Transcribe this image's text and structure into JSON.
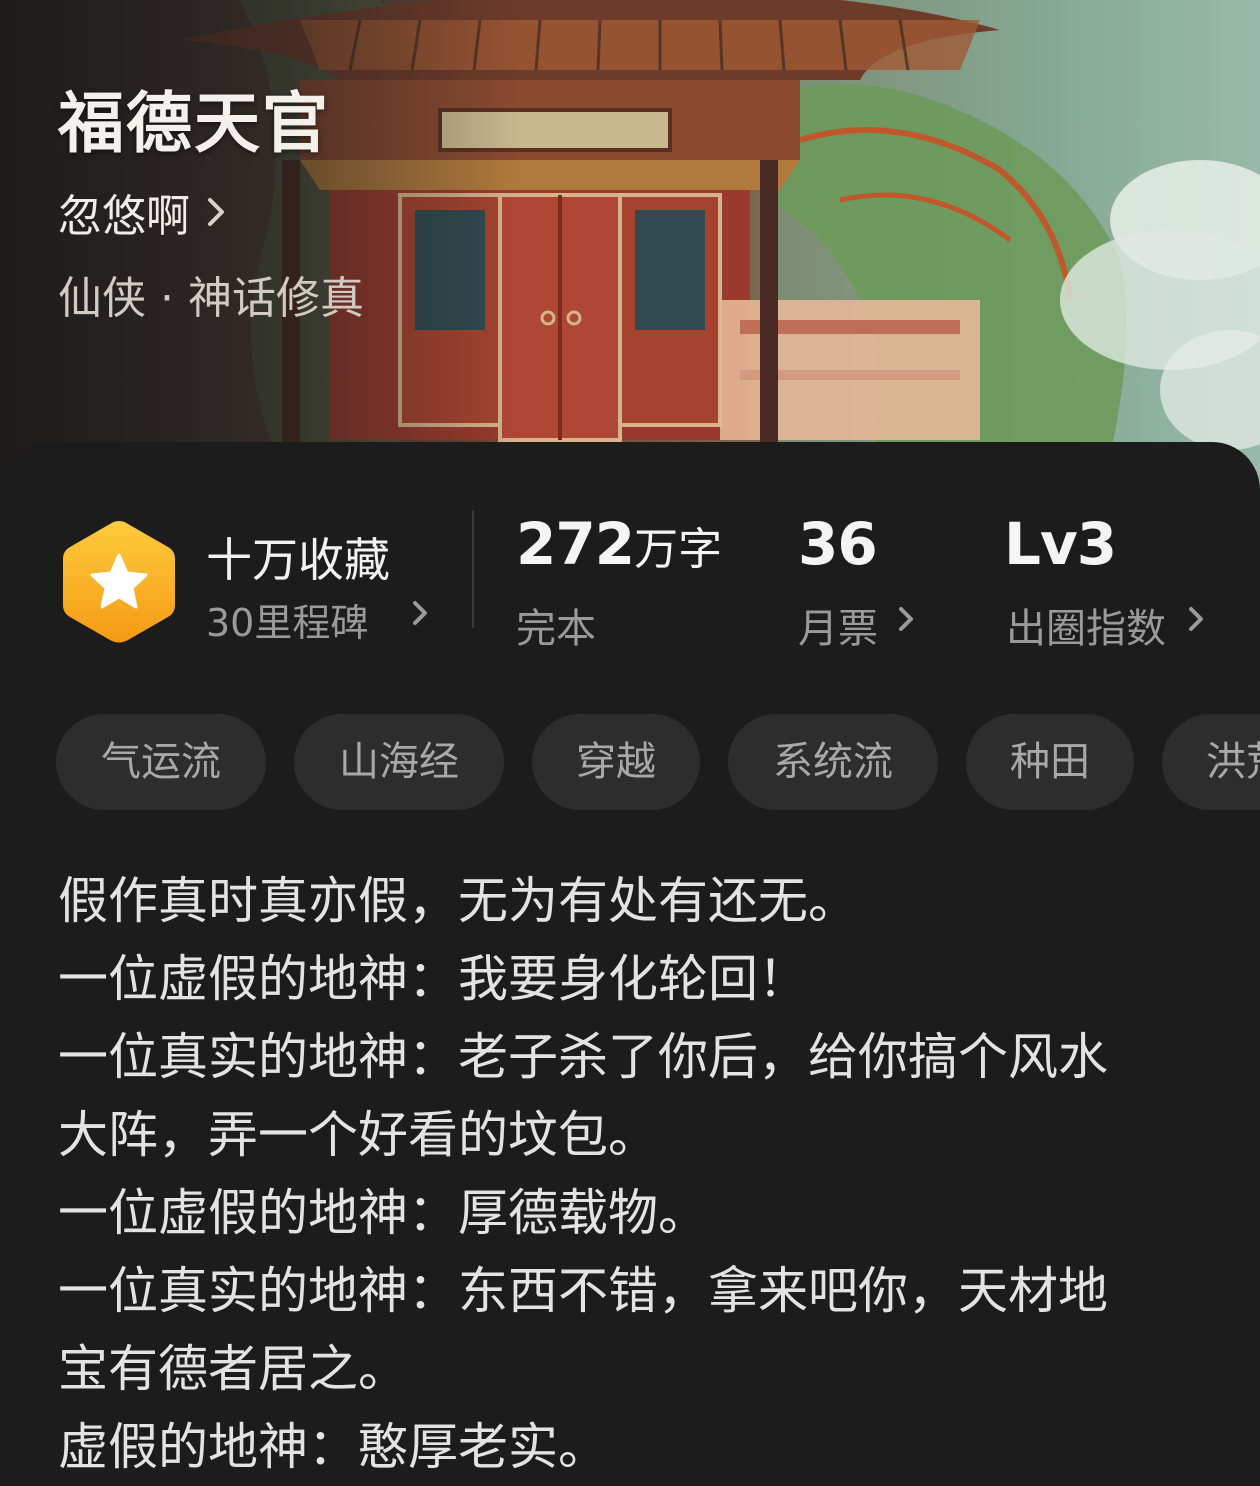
{
  "book": {
    "title": "福德天官",
    "author": "忽悠啊",
    "genre": "仙侠 · 神话修真"
  },
  "stats": {
    "favorites_label": "十万收藏",
    "milestone_label": "30里程碑",
    "word_count_number": "272",
    "word_count_unit": "万字",
    "status": "完本",
    "monthly_votes_value": "36",
    "monthly_votes_label": "月票",
    "level_value": "Lv3",
    "level_label": "出圈指数"
  },
  "tags": [
    "气运流",
    "山海经",
    "穿越",
    "系统流",
    "种田",
    "洪荒"
  ],
  "synopsis_lines": [
    "假作真时真亦假，无为有处有还无。",
    "一位虚假的地神：我要身化轮回！",
    "一位真实的地神：老子杀了你后，给你搞个风水",
    "大阵，弄一个好看的坟包。",
    "一位虚假的地神：厚德载物。",
    "一位真实的地神：东西不错，拿来吧你，天材地",
    "宝有德者居之。",
    "虚假的地神：憨厚老实。"
  ],
  "colors": {
    "background": "#1c1c1c",
    "tag_bg": "#2d2d2d",
    "badge_orange": "#f7a21b",
    "badge_yellow": "#ffc63a"
  },
  "icons": {
    "badge": "star-hexagon-icon",
    "chevron": "chevron-right-icon"
  }
}
